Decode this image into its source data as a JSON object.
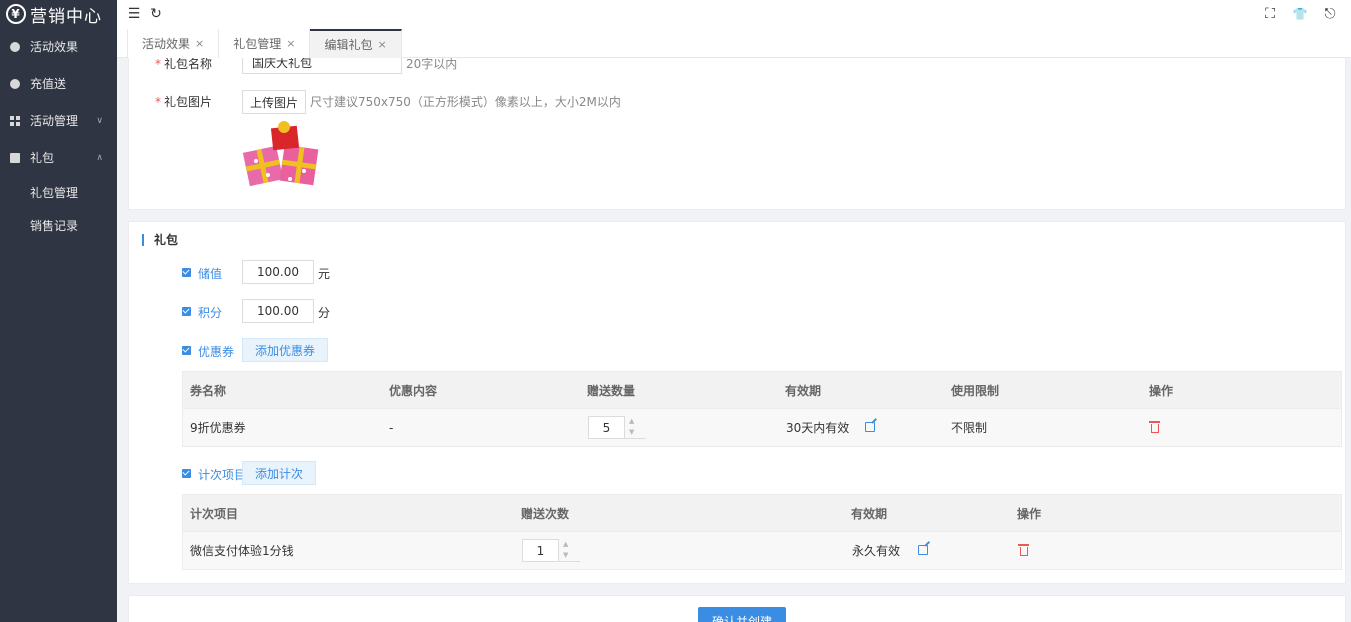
{
  "sidebar": {
    "logo": "营销中心",
    "logo_symbol": "¥",
    "items": [
      {
        "label": "活动效果",
        "icon": "pie-icon"
      },
      {
        "label": "充值送",
        "icon": "coin-icon"
      },
      {
        "label": "活动管理",
        "icon": "grid-icon",
        "arrow": "∨"
      },
      {
        "label": "礼包",
        "icon": "gift-icon",
        "arrow": "∧"
      }
    ],
    "sub_items": [
      {
        "label": "礼包管理"
      },
      {
        "label": "销售记录"
      }
    ]
  },
  "header": {
    "menu_icon": "☰",
    "refresh_icon": "↻",
    "fullscreen_icon": "⛶",
    "skin_icon": "👕",
    "logout_icon": "⎋"
  },
  "tabs": [
    {
      "label": "活动效果",
      "close": "×"
    },
    {
      "label": "礼包管理",
      "close": "×"
    },
    {
      "label": "编辑礼包",
      "close": "×",
      "active": true
    }
  ],
  "form": {
    "name_label": "礼包名称",
    "name_required": "*",
    "name_value": "国庆大礼包",
    "name_hint": "20字以内",
    "image_label": "礼包图片",
    "image_required": "*",
    "upload_button": "上传图片",
    "image_hint": "尺寸建议750x750（正方形模式）像素以上，大小2M以内"
  },
  "gift": {
    "section_title": "礼包",
    "stored_value": {
      "label": "储值",
      "value": "100.00",
      "unit": "元"
    },
    "points": {
      "label": "积分",
      "value": "100.00",
      "unit": "分"
    },
    "coupons": {
      "label": "优惠券",
      "add_button": "添加优惠券"
    },
    "coupon_table": {
      "headers": [
        "券名称",
        "优惠内容",
        "赠送数量",
        "有效期",
        "使用限制",
        "操作"
      ],
      "rows": [
        {
          "name": "9折优惠券",
          "content": "-",
          "quantity": "5",
          "validity": "30天内有效",
          "limit": "不限制"
        }
      ]
    },
    "count_items": {
      "label": "计次项目",
      "add_button": "添加计次"
    },
    "count_table": {
      "headers": [
        "计次项目",
        "赠送次数",
        "有效期",
        "操作"
      ],
      "rows": [
        {
          "name": "微信支付体验1分钱",
          "times": "1",
          "validity": "永久有效"
        }
      ]
    }
  },
  "footer": {
    "confirm_button": "确认并创建"
  },
  "colors": {
    "sidebar_bg": "#2f3542",
    "accent": "#3b8de4",
    "danger": "#ee5555"
  }
}
